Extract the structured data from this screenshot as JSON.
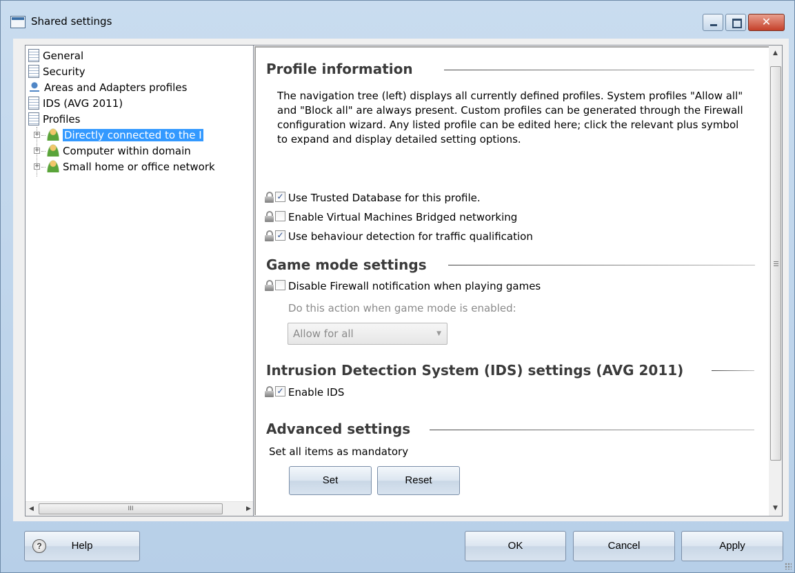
{
  "window": {
    "title": "Shared settings"
  },
  "tree": {
    "items": [
      {
        "label": "General",
        "icon": "document-icon"
      },
      {
        "label": "Security",
        "icon": "document-icon"
      },
      {
        "label": "Areas and Adapters profiles",
        "icon": "network-icon"
      },
      {
        "label": "IDS (AVG 2011)",
        "icon": "document-icon"
      },
      {
        "label": "Profiles",
        "icon": "document-icon"
      }
    ],
    "profiles": [
      {
        "label": "Directly connected to the I",
        "selected": true
      },
      {
        "label": "Computer within domain",
        "selected": false
      },
      {
        "label": "Small home or office network",
        "selected": false
      }
    ],
    "scrollbar_thumb": "III"
  },
  "profile_info": {
    "title": "Profile information",
    "description": "The navigation tree (left) displays all currently defined profiles. System profiles \"Allow all\" and \"Block all\" are always present. Custom profiles can be generated through the Firewall configuration wizard. Any listed profile can be edited here; click the relevant plus symbol to expand and display detailed setting options."
  },
  "options": [
    {
      "label": "Use Trusted Database for this profile.",
      "checked": true
    },
    {
      "label": "Enable Virtual Machines Bridged networking",
      "checked": false
    },
    {
      "label": "Use behaviour detection for traffic qualification",
      "checked": true
    }
  ],
  "game_mode": {
    "title": "Game mode settings",
    "option": {
      "label": "Disable Firewall notification when playing games",
      "checked": false
    },
    "action_label": "Do this action when game mode is enabled:",
    "action_value": "Allow for all"
  },
  "ids": {
    "title": "Intrusion Detection System (IDS) settings (AVG 2011)",
    "option": {
      "label": "Enable IDS",
      "checked": true
    }
  },
  "advanced": {
    "title": "Advanced settings",
    "mandatory_label": "Set all items as mandatory",
    "set_label": "Set",
    "reset_label": "Reset"
  },
  "footer": {
    "help_label": "Help",
    "ok_label": "OK",
    "cancel_label": "Cancel",
    "apply_label": "Apply"
  },
  "check_mark": "✓",
  "colors": {
    "selection": "#3399ff",
    "close_button": "#c5402a"
  }
}
